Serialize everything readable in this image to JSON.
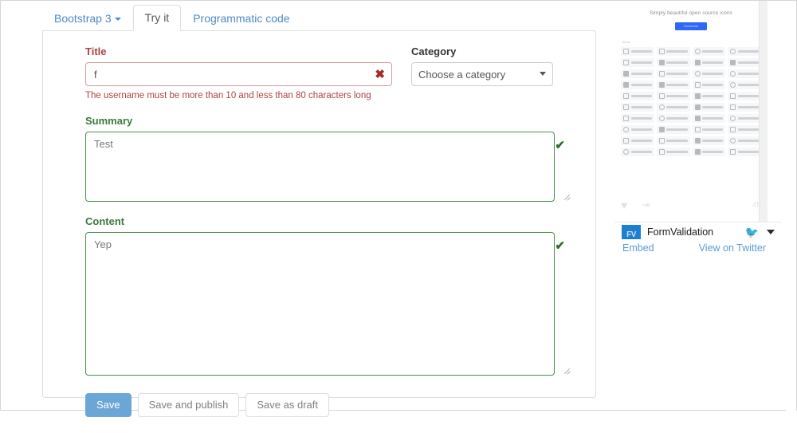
{
  "tabs": [
    {
      "label": "Bootstrap 3",
      "type": "dropdown",
      "active": false,
      "name": "tab-bootstrap3"
    },
    {
      "label": "Try it",
      "type": "tab",
      "active": true,
      "name": "tab-try-it"
    },
    {
      "label": "Programmatic code",
      "type": "tab",
      "active": false,
      "name": "tab-programmatic-code"
    }
  ],
  "form": {
    "title": {
      "label": "Title",
      "value": "f",
      "placeholder": "",
      "state": "error",
      "icon": "cross-icon",
      "error_message": "The username must be more than 10 and less than 80 characters long"
    },
    "category": {
      "label": "Category",
      "selected": "Choose a category",
      "options": [
        "Choose a category"
      ],
      "state": "neutral"
    },
    "summary": {
      "label": "Summary",
      "value": "Test",
      "placeholder": "",
      "state": "valid",
      "icon": "check-icon"
    },
    "content": {
      "label": "Content",
      "value": "Yep",
      "placeholder": "",
      "state": "valid",
      "icon": "check-icon"
    },
    "buttons": [
      {
        "label": "Save",
        "style": "primary",
        "name": "save-button"
      },
      {
        "label": "Save and publish",
        "style": "default",
        "name": "save-and-publish-button"
      },
      {
        "label": "Save as draft",
        "style": "default",
        "name": "save-as-draft-button"
      }
    ]
  },
  "sidebar": {
    "promo": {
      "tagline": "Simply beautiful open source icons",
      "download_label": "Download",
      "section_label": "Icons"
    },
    "tweet_actions": {
      "heart": "♥",
      "share": "⇥",
      "timestamp": "4h"
    },
    "twitter": {
      "avatar_text": "FV",
      "account_name": "FormValidation",
      "embed_link": "Embed",
      "view_link": "View on Twitter"
    }
  },
  "colors": {
    "error": "#a94442",
    "valid": "#3c763d",
    "primary": "#6aa6d6",
    "link": "#4e8cc4",
    "twitter_blue": "#1d7fd0",
    "download_blue": "#2f68f5"
  }
}
